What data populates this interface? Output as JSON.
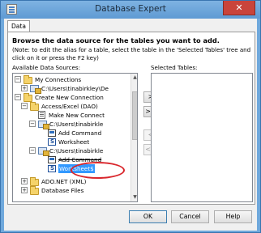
{
  "window": {
    "title": "Database Expert",
    "close_glyph": "✕"
  },
  "tab": {
    "label": "Data"
  },
  "heading": "Browse the data source for the tables you want to add.",
  "note": "(Note: to edit the alias for a table, select the table in the 'Selected Tables' tree and click on it or press the F2 key)",
  "available_label": "Available Data Sources:",
  "selected_label": "Selected Tables:",
  "tree": [
    {
      "label": "My Connections",
      "icon": "folder-icon",
      "expander": "−"
    },
    {
      "label": "C:\\Users\\tinabirkley\\De",
      "icon": "connection-icon",
      "expander": "+"
    },
    {
      "label": "Create New Connection",
      "icon": "folder-icon",
      "expander": "−"
    },
    {
      "label": "Access/Excel (DAO)",
      "icon": "folder-icon",
      "expander": "−"
    },
    {
      "label": "Make New Connect",
      "icon": "document-icon",
      "expander": ""
    },
    {
      "label": "C:\\Users\\tinabirkle",
      "icon": "connection-icon",
      "expander": "−"
    },
    {
      "label": "Add Command",
      "icon": "command-icon",
      "expander": ""
    },
    {
      "label": "Worksheet",
      "icon": "table-icon",
      "expander": ""
    },
    {
      "label": "C:\\Users\\tinabirkle",
      "icon": "connection-icon",
      "expander": "−"
    },
    {
      "label": "Add Command",
      "icon": "command-icon",
      "expander": ""
    },
    {
      "label": "Worksheet$",
      "icon": "table-icon",
      "expander": ""
    },
    {
      "label": "ADO.NET (XML)",
      "icon": "folder-icon",
      "expander": "+"
    },
    {
      "label": "Database Files",
      "icon": "folder-icon",
      "expander": "+"
    }
  ],
  "transfer_buttons": {
    "add_one": ">",
    "add_all": ">>",
    "remove_one": "<",
    "remove_all": "<<"
  },
  "buttons": {
    "ok": "OK",
    "cancel": "Cancel",
    "help": "Help"
  },
  "colors": {
    "selection": "#3399ff",
    "annotation": "#d9262c",
    "title_bar": "#6fa8dc"
  }
}
